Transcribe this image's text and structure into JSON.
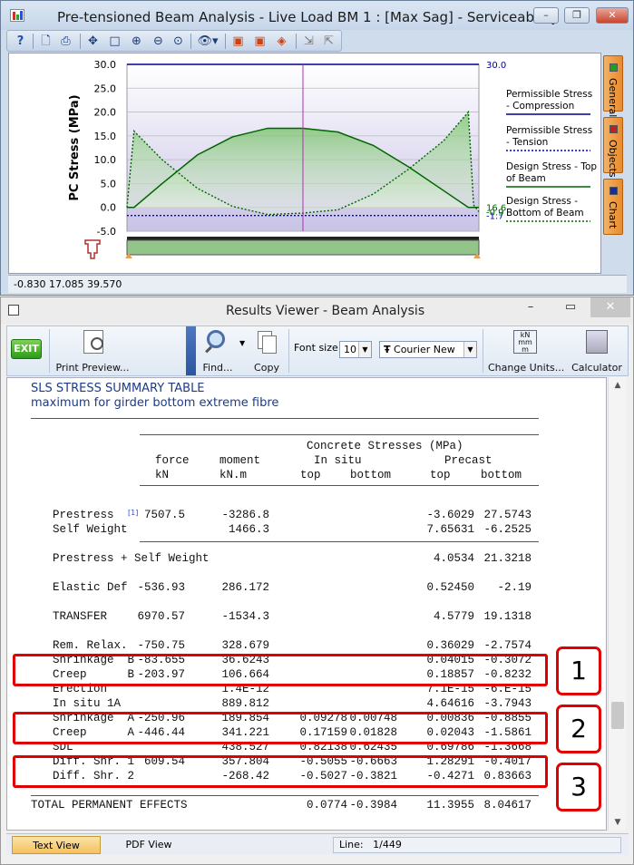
{
  "chart_window": {
    "title": "Pre-tensioned Beam Analysis - Live Load BM 1 : [Max Sag] - Serviceability",
    "side_tabs": [
      "General",
      "Objects",
      "Chart"
    ],
    "status_coords": "-0.830  17.085  39.570"
  },
  "chart_data": {
    "type": "line",
    "ylabel": "PC Stress (MPa)",
    "xlim": [
      0,
      1
    ],
    "ylim": [
      -5,
      30
    ],
    "yticks": [
      "30.0",
      "25.0",
      "20.0",
      "15.0",
      "10.0",
      "5.0",
      "0.0",
      "-5.0"
    ],
    "grid": true,
    "legend_position": "right",
    "series": [
      {
        "name": "Permissible Stress - Compression",
        "color": "#00008b",
        "style": "solid",
        "x": [
          0,
          1
        ],
        "y": [
          30.0,
          30.0
        ],
        "end_label": "30.0"
      },
      {
        "name": "Permissible Stress - Tension",
        "color": "#0000cc",
        "style": "dotted",
        "x": [
          0,
          1
        ],
        "y": [
          -1.7,
          -1.7
        ],
        "end_label": "-1.7"
      },
      {
        "name": "Design Stress - Top of Beam",
        "color": "#006400",
        "style": "solid",
        "x": [
          0,
          0.02,
          0.1,
          0.2,
          0.3,
          0.4,
          0.5,
          0.6,
          0.7,
          0.8,
          0.9,
          0.97,
          1.0
        ],
        "y": [
          0,
          0,
          5.0,
          11.0,
          14.8,
          16.6,
          16.6,
          15.8,
          13.0,
          8.5,
          3.5,
          0,
          0
        ],
        "end_label": "16.6"
      },
      {
        "name": "Design Stress - Bottom of Beam",
        "color": "#006400",
        "style": "dotted",
        "x": [
          0,
          0.02,
          0.1,
          0.2,
          0.3,
          0.4,
          0.5,
          0.6,
          0.7,
          0.8,
          0.9,
          0.97,
          0.985,
          1.0
        ],
        "y": [
          0,
          16.0,
          10.0,
          4.0,
          0.2,
          -1.5,
          -1.2,
          -0.5,
          2.8,
          8.0,
          14.0,
          20.0,
          0.5,
          -0.9
        ],
        "end_label": "-0.9"
      }
    ],
    "cursor_x": 0.5
  },
  "results_window": {
    "title": "Results Viewer - Beam Analysis",
    "toolbar": {
      "exit": "EXIT",
      "print_preview": "Print Preview...",
      "find": "Find...",
      "copy": "Copy",
      "font_size_label": "Font size",
      "font_size_value": "10",
      "font_name": "Courier New",
      "change_units": "Change Units...",
      "calculator": "Calculator",
      "units_icon": [
        "kN",
        "mm",
        "m"
      ]
    },
    "heading1": "SLS STRESS SUMMARY TABLE",
    "heading2": "maximum for girder bottom extreme fibre",
    "col_group": "Concrete Stresses (MPa)",
    "col_insitu": "In situ",
    "col_precast": "Precast",
    "col_force": "force",
    "col_moment": "moment",
    "col_force_unit": "kN",
    "col_moment_unit": "kN.m",
    "col_top1": "top",
    "col_bottom1": "bottom",
    "col_top2": "top",
    "col_bottom2": "bottom",
    "footnote_mark": "[1]",
    "rows": [
      {
        "label": "Prestress",
        "force": "7507.5",
        "moment": "-3286.8",
        "it": "",
        "ib": "",
        "pt": "-3.6029",
        "pb": "27.5743"
      },
      {
        "label": "Self Weight",
        "force": "",
        "moment": "1466.3",
        "it": "",
        "ib": "",
        "pt": "7.65631",
        "pb": "-6.2525"
      },
      {
        "label": "Prestress + Self Weight",
        "force": "",
        "moment": "",
        "it": "",
        "ib": "",
        "pt": "4.0534",
        "pb": "21.3218"
      },
      {
        "label": "Elastic Def",
        "force": "-536.93",
        "moment": "286.172",
        "it": "",
        "ib": "",
        "pt": "0.52450",
        "pb": "-2.19"
      },
      {
        "label": "TRANSFER",
        "force": "6970.57",
        "moment": "-1534.3",
        "it": "",
        "ib": "",
        "pt": "4.5779",
        "pb": "19.1318"
      },
      {
        "label": "Rem. Relax.",
        "force": "-750.75",
        "moment": "328.679",
        "it": "",
        "ib": "",
        "pt": "0.36029",
        "pb": "-2.7574"
      },
      {
        "label": "Shrinkage  B",
        "force": "-83.655",
        "moment": "36.6243",
        "it": "",
        "ib": "",
        "pt": "0.04015",
        "pb": "-0.3072"
      },
      {
        "label": "Creep      B",
        "force": "-203.97",
        "moment": "106.664",
        "it": "",
        "ib": "",
        "pt": "0.18857",
        "pb": "-0.8232"
      },
      {
        "label": "Erection",
        "force": "",
        "moment": "1.4E-12",
        "it": "",
        "ib": "",
        "pt": "7.1E-15",
        "pb": "-6.E-15"
      },
      {
        "label": "In situ 1A",
        "force": "",
        "moment": "889.812",
        "it": "",
        "ib": "",
        "pt": "4.64616",
        "pb": "-3.7943"
      },
      {
        "label": "Shrinkage  A",
        "force": "-250.96",
        "moment": "189.854",
        "it": "0.09278",
        "ib": "0.00748",
        "pt": "0.00836",
        "pb": "-0.8855"
      },
      {
        "label": "Creep      A",
        "force": "-446.44",
        "moment": "341.221",
        "it": "0.17159",
        "ib": "0.01828",
        "pt": "0.02043",
        "pb": "-1.5861"
      },
      {
        "label": "SDL",
        "force": "",
        "moment": "438.527",
        "it": "0.82138",
        "ib": "0.62435",
        "pt": "0.69786",
        "pb": "-1.3668"
      },
      {
        "label": "Diff. Shr. 1",
        "force": "609.54",
        "moment": "357.804",
        "it": "-0.5055",
        "ib": "-0.6663",
        "pt": "1.28291",
        "pb": "-0.4017"
      },
      {
        "label": "Diff. Shr. 2",
        "force": "",
        "moment": "-268.42",
        "it": "-0.5027",
        "ib": "-0.3821",
        "pt": "-0.4271",
        "pb": "0.83663"
      },
      {
        "label": "TOTAL PERMANENT EFFECTS",
        "force": "",
        "moment": "",
        "it": "0.0774",
        "ib": "-0.3984",
        "pt": "11.3955",
        "pb": "8.04617"
      }
    ],
    "callouts": [
      "1",
      "2",
      "3"
    ],
    "tabs": [
      "Text View",
      "PDF View"
    ],
    "line_label": "Line:",
    "line_value": "1/449"
  }
}
